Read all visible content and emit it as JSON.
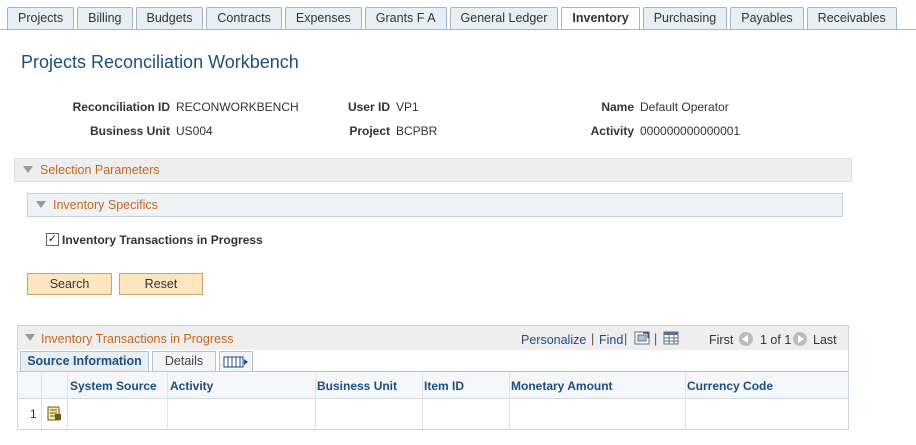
{
  "tabs": [
    {
      "label": "Projects",
      "active": false
    },
    {
      "label": "Billing",
      "active": false
    },
    {
      "label": "Budgets",
      "active": false
    },
    {
      "label": "Contracts",
      "active": false
    },
    {
      "label": "Expenses",
      "active": false
    },
    {
      "label": "Grants F A",
      "active": false
    },
    {
      "label": "General Ledger",
      "active": false
    },
    {
      "label": "Inventory",
      "active": true
    },
    {
      "label": "Purchasing",
      "active": false
    },
    {
      "label": "Payables",
      "active": false
    },
    {
      "label": "Receivables",
      "active": false
    }
  ],
  "page_title": "Projects Reconciliation Workbench",
  "info": {
    "reconciliation_id": {
      "label": "Reconciliation ID",
      "value": "RECONWORKBENCH"
    },
    "business_unit": {
      "label": "Business Unit",
      "value": "US004"
    },
    "user_id": {
      "label": "User ID",
      "value": "VP1"
    },
    "project": {
      "label": "Project",
      "value": "BCPBR"
    },
    "name": {
      "label": "Name",
      "value": "Default Operator"
    },
    "activity": {
      "label": "Activity",
      "value": "000000000000001"
    }
  },
  "selection_parameters": {
    "label": "Selection Parameters"
  },
  "inventory_specifics": {
    "label": "Inventory Specifics"
  },
  "checkbox": {
    "label": "Inventory Transactions in Progress",
    "checked": true,
    "mark": "✓"
  },
  "buttons": {
    "search": "Search",
    "reset": "Reset"
  },
  "grid": {
    "title": "Inventory Transactions in Progress",
    "personalize": "Personalize",
    "sep": "|",
    "find": "Find",
    "first": "First",
    "range": "1 of 1",
    "last": "Last",
    "tabs": {
      "source": "Source Information",
      "details": "Details"
    },
    "columns": [
      "System Source",
      "Activity",
      "Business Unit",
      "Item ID",
      "Monetary Amount",
      "Currency Code"
    ],
    "rows": [
      {
        "num": "1"
      }
    ]
  },
  "colors": {
    "accent": "#1c4e80",
    "section": "#c8651b",
    "button": "#fde6bf"
  }
}
